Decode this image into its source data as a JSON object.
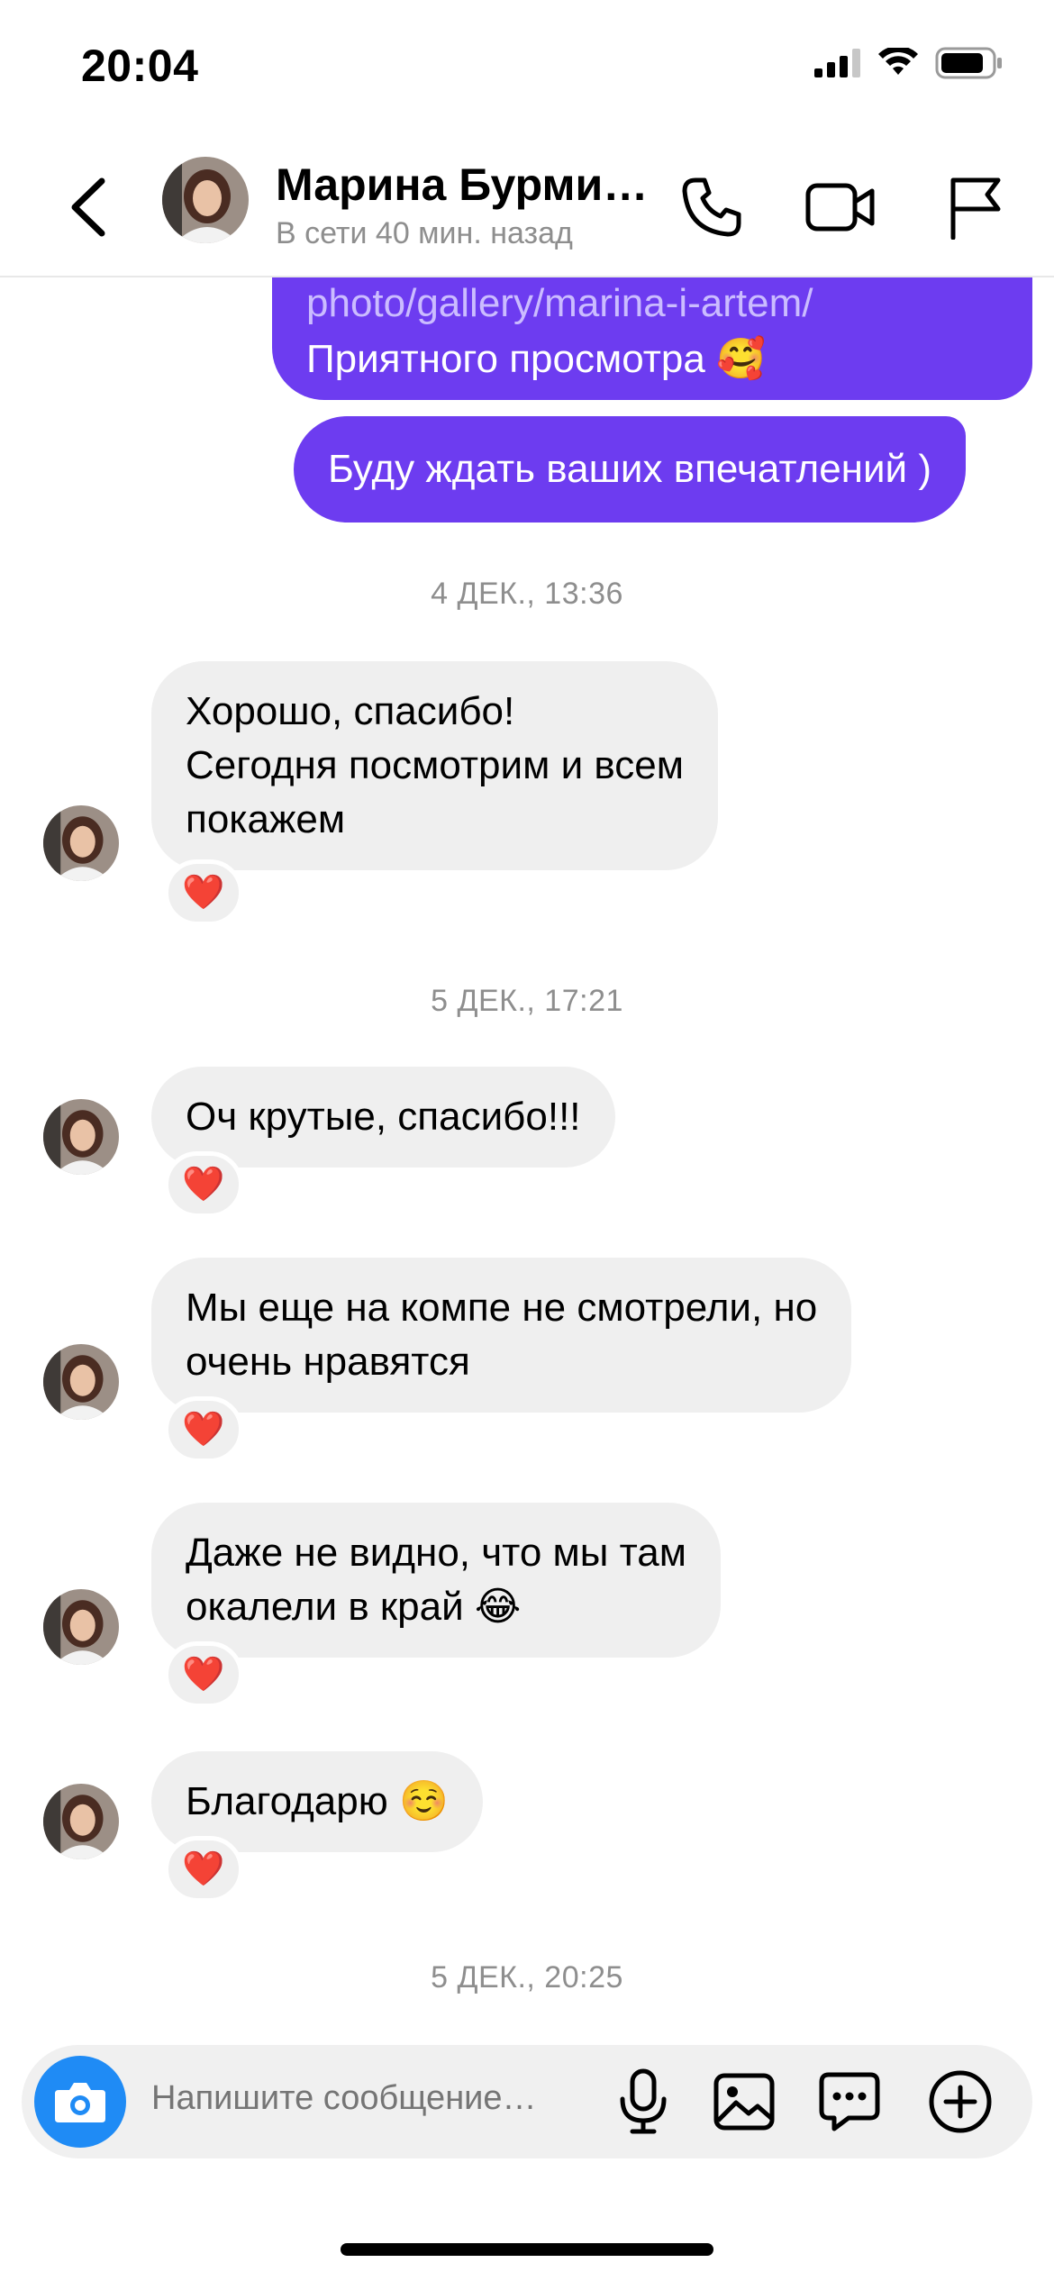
{
  "status_bar": {
    "time": "20:04"
  },
  "header": {
    "contact_name": "Марина Бурмистрова",
    "contact_status": "В сети 40 мин. назад"
  },
  "outgoing": {
    "link_partial": "photo/gallery/marina-i-artem/",
    "link_caption": "Приятного просмотра 🥰",
    "message_2": "Буду ждать ваших впечатлений )"
  },
  "timestamps": [
    "4 ДЕК., 13:36",
    "5 ДЕК., 17:21",
    "5 ДЕК., 20:25"
  ],
  "incoming": [
    {
      "lines": [
        "Хорошо, спасибо!",
        "Сегодня посмотрим и всем",
        "покажем"
      ],
      "reaction": "❤️"
    },
    {
      "lines": [
        "Оч крутые, спасибо!!!"
      ],
      "reaction": "❤️"
    },
    {
      "lines": [
        "Мы еще на компе не смотрели, но",
        "очень нравятся"
      ],
      "reaction": "❤️"
    },
    {
      "lines": [
        "Даже не видно, что мы там",
        "окалели в край 😂"
      ],
      "reaction": "❤️"
    },
    {
      "lines": [
        "Благодарю ☺️"
      ],
      "reaction": "❤️"
    }
  ],
  "composer": {
    "placeholder": "Напишите сообщение…"
  },
  "icons": {
    "back": "chevron-left-icon",
    "call": "phone-icon",
    "video": "video-camera-icon",
    "report": "flag-icon",
    "camera": "camera-icon",
    "mic": "microphone-icon",
    "gallery": "image-icon",
    "sticker": "chat-bubble-icon",
    "more": "plus-circle-icon"
  },
  "colors": {
    "outgoing_bubble": "#6d3cf0",
    "incoming_bubble": "#efefef",
    "camera_button": "#1f8bf5",
    "secondary_text": "#8e8e8e"
  }
}
